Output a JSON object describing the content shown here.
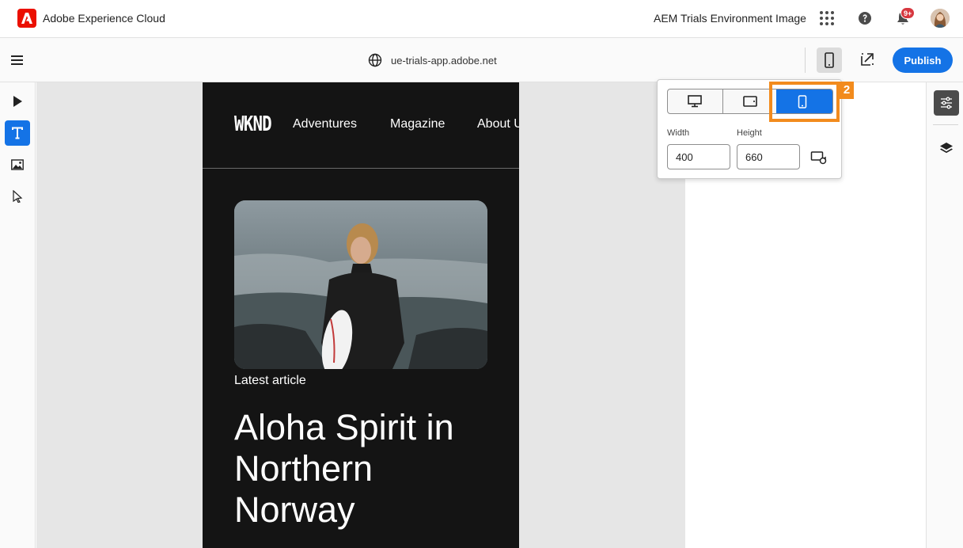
{
  "shell": {
    "brand": "Adobe Experience Cloud",
    "environment": "AEM Trials Environment Image",
    "notification_badge": "9+"
  },
  "toolbar": {
    "url": "ue-trials-app.adobe.net",
    "publish_label": "Publish"
  },
  "site": {
    "logo": "WKND",
    "nav": [
      "Adventures",
      "Magazine",
      "About U"
    ],
    "kicker": "Latest article",
    "headline": "Aloha Spirit in Northern Norway"
  },
  "popover": {
    "width_label": "Width",
    "width_value": "400",
    "height_label": "Height",
    "height_value": "660",
    "selected_device": "mobile"
  },
  "annotation": {
    "step": "2"
  },
  "colors": {
    "accent": "#1473e6",
    "brand_red": "#eb1000",
    "callout": "#f28b1d",
    "site_bg": "#141414"
  }
}
